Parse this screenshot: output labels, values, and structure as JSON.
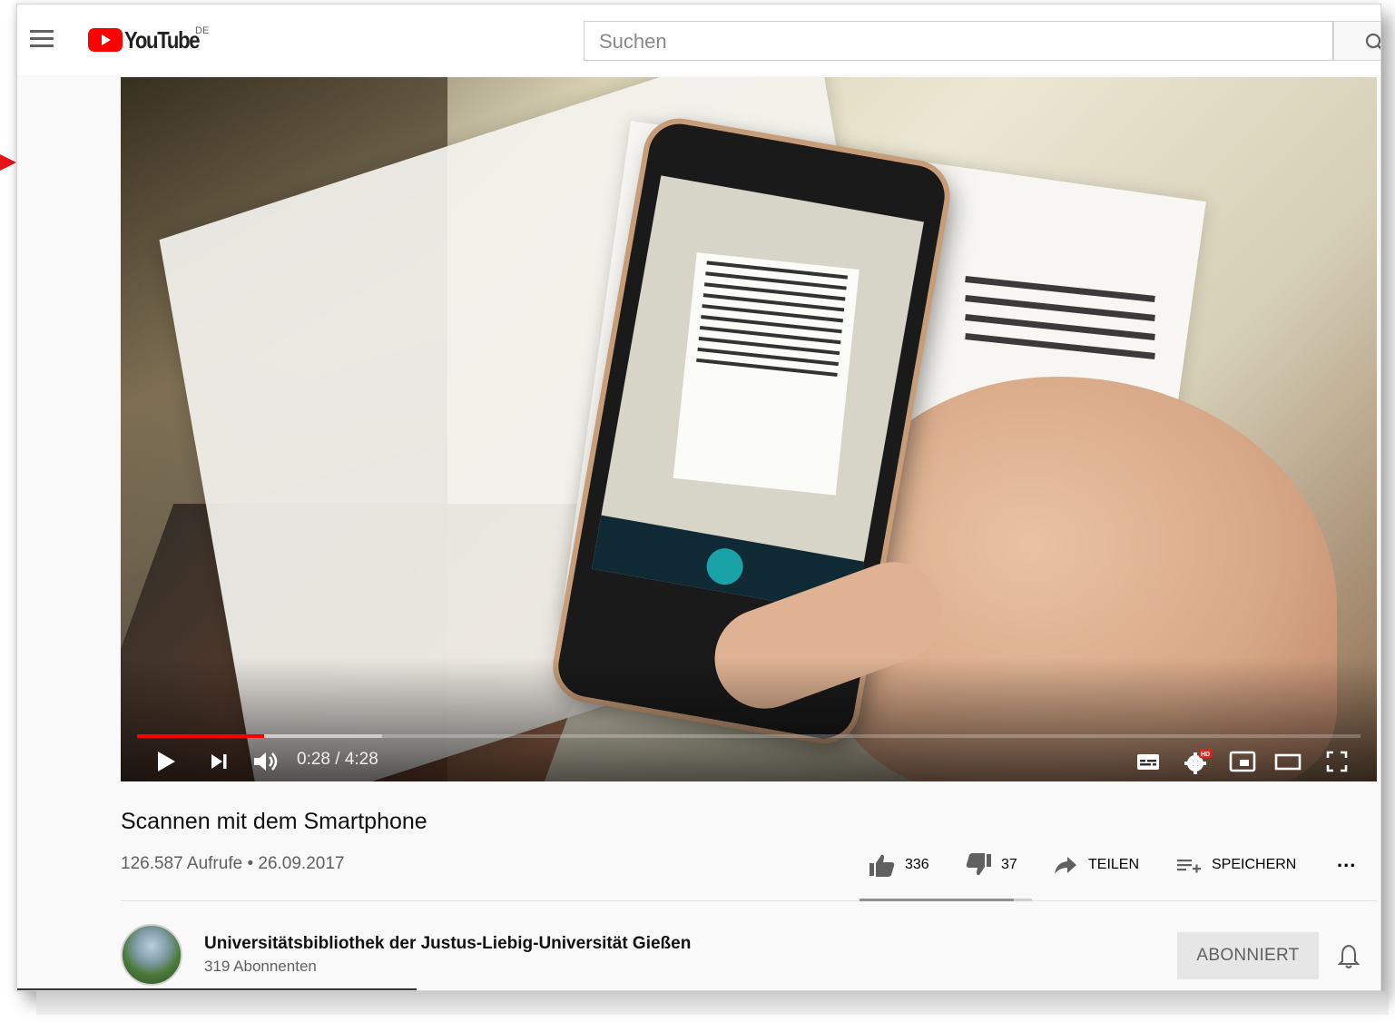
{
  "masthead": {
    "logo_text": "YouTube",
    "region": "DE",
    "search_placeholder": "Suchen"
  },
  "player": {
    "time": "0:28 / 4:28",
    "progress_fraction": 0.104,
    "buffer_fraction": 0.2,
    "controls": [
      "play-icon",
      "next-icon",
      "volume-icon",
      "subtitles-icon",
      "settings-hd-icon",
      "miniplayer-icon",
      "theater-icon",
      "fullscreen-icon"
    ]
  },
  "video": {
    "title": "Scannen mit dem Smartphone",
    "meta": "126.587 Aufrufe • 26.09.2017"
  },
  "actions": {
    "likes": "336",
    "dislikes": "37",
    "share": "TEILEN",
    "save": "SPEICHERN",
    "more": "..."
  },
  "channel": {
    "name": "Universitätsbibliothek der Justus-Liebig-Universität Gießen",
    "subscribers": "319 Abonnenten",
    "subscribe_label": "ABONNIERT"
  },
  "colors": {
    "accent": "#ff0000",
    "annotation_arrow": "#e8141c"
  }
}
